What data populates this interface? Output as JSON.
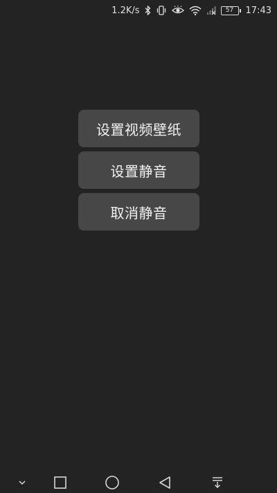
{
  "status_bar": {
    "network_speed": "1.2K/s",
    "battery_level": "57",
    "time": "17:43",
    "icons": [
      "bluetooth-icon",
      "vibrate-icon",
      "eye-comfort-icon",
      "wifi-icon",
      "no-signal-icon",
      "battery-icon"
    ]
  },
  "menu": {
    "buttons": [
      {
        "label": "设置视频壁纸"
      },
      {
        "label": "设置静音"
      },
      {
        "label": "取消静音"
      }
    ]
  },
  "nav_bar": {
    "icons": [
      "chevron-down-icon",
      "recents-square-icon",
      "home-circle-icon",
      "back-triangle-icon",
      "notification-pull-icon"
    ]
  },
  "colors": {
    "background": "#232323",
    "button_background": "#474747",
    "text": "#f2f2f2"
  }
}
